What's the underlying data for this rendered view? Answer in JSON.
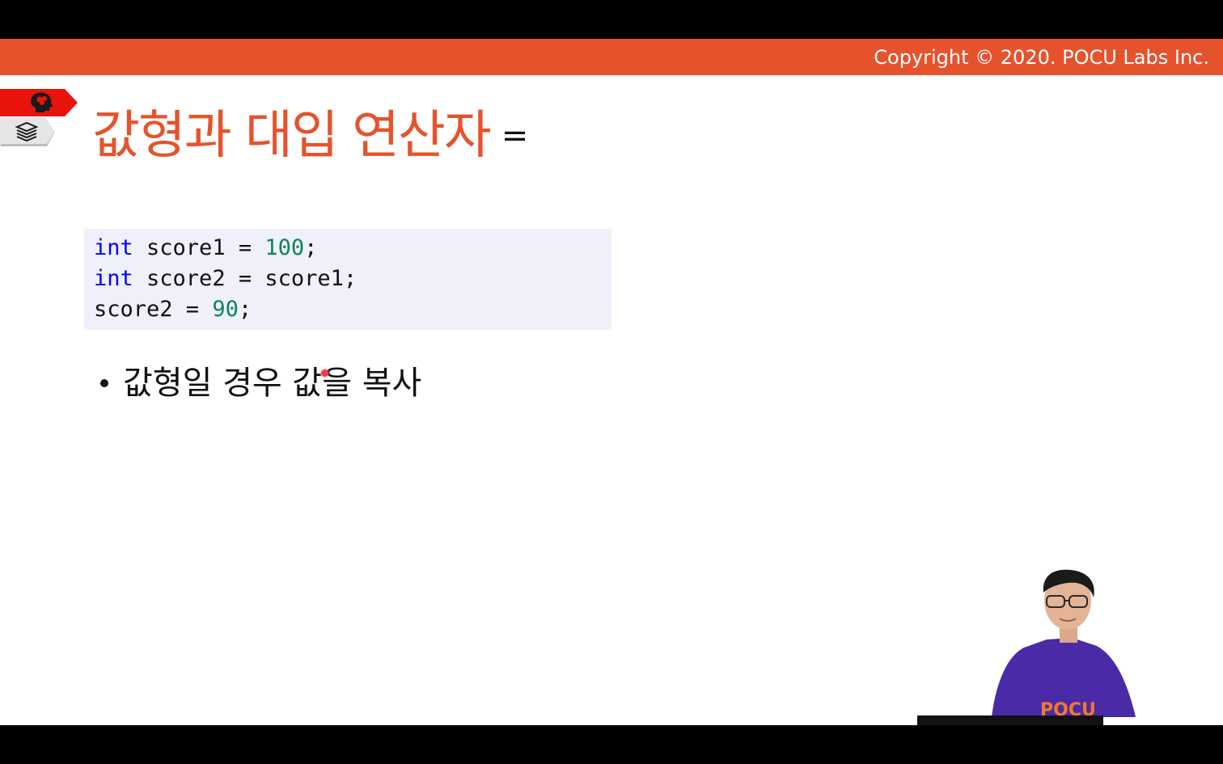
{
  "header": {
    "copyright": "Copyright © 2020. POCU Labs Inc.",
    "accent_color": "#e5532d"
  },
  "side_tabs": [
    {
      "icon": "brain-head-icon",
      "color": "#e8140c"
    },
    {
      "icon": "book-stack-icon",
      "color": "#e6e6e6"
    }
  ],
  "slide": {
    "title": "값형과 대입 연산자",
    "title_operator": "=",
    "code_lines": [
      {
        "keyword": "int",
        "text": " score1 = ",
        "number": "100",
        "end": ";"
      },
      {
        "keyword": "int",
        "text": " score2 = score1;",
        "number": "",
        "end": ""
      },
      {
        "keyword": "",
        "text": "score2 = ",
        "number": "90",
        "end": ";"
      }
    ],
    "bullets": [
      "값형일 경우 값을 복사"
    ]
  },
  "presenter": {
    "shirt_text": "POCU"
  }
}
